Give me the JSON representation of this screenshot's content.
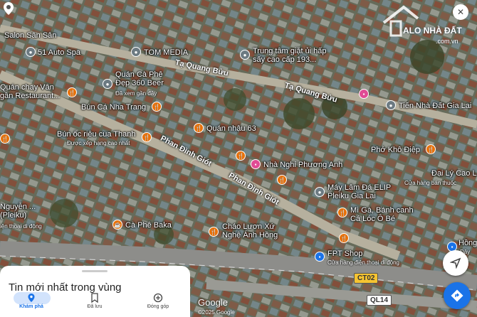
{
  "map": {
    "streets": [
      {
        "name": "Tạ Quang Bửu"
      },
      {
        "name": "Tạ Quang Bửu"
      },
      {
        "name": "Phan Đình Giót"
      },
      {
        "name": "Phan Đình Giót"
      }
    ],
    "pois": [
      {
        "name": "Salon Sân Sân",
        "icon": "none"
      },
      {
        "name": "51 Auto Spa",
        "icon": "pin-icon"
      },
      {
        "name": "TOM MEDIA",
        "icon": "pin-icon"
      },
      {
        "name": "Trung tâm giặt ủi hấp sấy cao cấp 193...",
        "icon": "pin-icon"
      },
      {
        "name": "Quán Cà Phê Đẹp 360 Beer",
        "sub": "Đã xem gần đây",
        "icon": "pin-icon"
      },
      {
        "name": "Quán chay Vân gần Restaurant...",
        "icon": "food-icon"
      },
      {
        "name": "Bún Cá Nha Trang",
        "icon": "food-icon"
      },
      {
        "name": "Tiến Nhà Đất Gia Lai",
        "icon": "pin-icon"
      },
      {
        "name": "Bún ốc riêu cua Thanh",
        "sub": "Được xếp hạng cao nhất",
        "icon": "food-icon"
      },
      {
        "name": "Quán nhậu 63",
        "icon": "food-icon"
      },
      {
        "name": "Phở Khô Điệp",
        "icon": "food-icon"
      },
      {
        "name": "Nhà Nghỉ Phương Anh",
        "icon": "hotel-icon"
      },
      {
        "name": "Đại Lý Cao L...",
        "sub": "Cửa hàng bán thuốc",
        "icon": "none"
      },
      {
        "name": "Máy Lâm Đá ELIP Pleiku Gia Lai",
        "icon": "pin-icon"
      },
      {
        "name": "Nguyễn ... (Pleiku)",
        "sub": "iện thoại di động",
        "icon": "none"
      },
      {
        "name": "Mì Gà, Bánh canh Cá Lóc Ô Bé",
        "icon": "food-icon"
      },
      {
        "name": "Cà Phê Baka",
        "icon": "coffee-icon"
      },
      {
        "name": "Cháo Lươn Xứ Nghệ Ánh Hồng",
        "icon": "food-icon"
      },
      {
        "name": "FPT Shop",
        "sub": "Cửa hàng điện thoại di động",
        "icon": "shop-icon"
      },
      {
        "name": "Hồng",
        "sub": "Đây",
        "icon": "shop-icon"
      }
    ],
    "shields": {
      "ct02": "CT02",
      "ql14": "QL14"
    },
    "google_logo": "Google",
    "copyright": "©2025 Google"
  },
  "watermark": {
    "text": "ALO NHÀ ĐẤT",
    "sub": ".com.vn"
  },
  "sheet": {
    "title": "Tin mới nhất trong vùng"
  },
  "bottom_nav": [
    {
      "label": "Khám phá",
      "icon": "explore-icon",
      "active": true
    },
    {
      "label": "Đã lưu",
      "icon": "bookmark-icon",
      "active": false
    },
    {
      "label": "Đóng góp",
      "icon": "add-circle-icon",
      "active": false
    }
  ],
  "colors": {
    "accent": "#1a73e8",
    "food_pin": "#e8710a",
    "hotel_pin": "#e04b94",
    "shield_ct": "#f6c431"
  }
}
